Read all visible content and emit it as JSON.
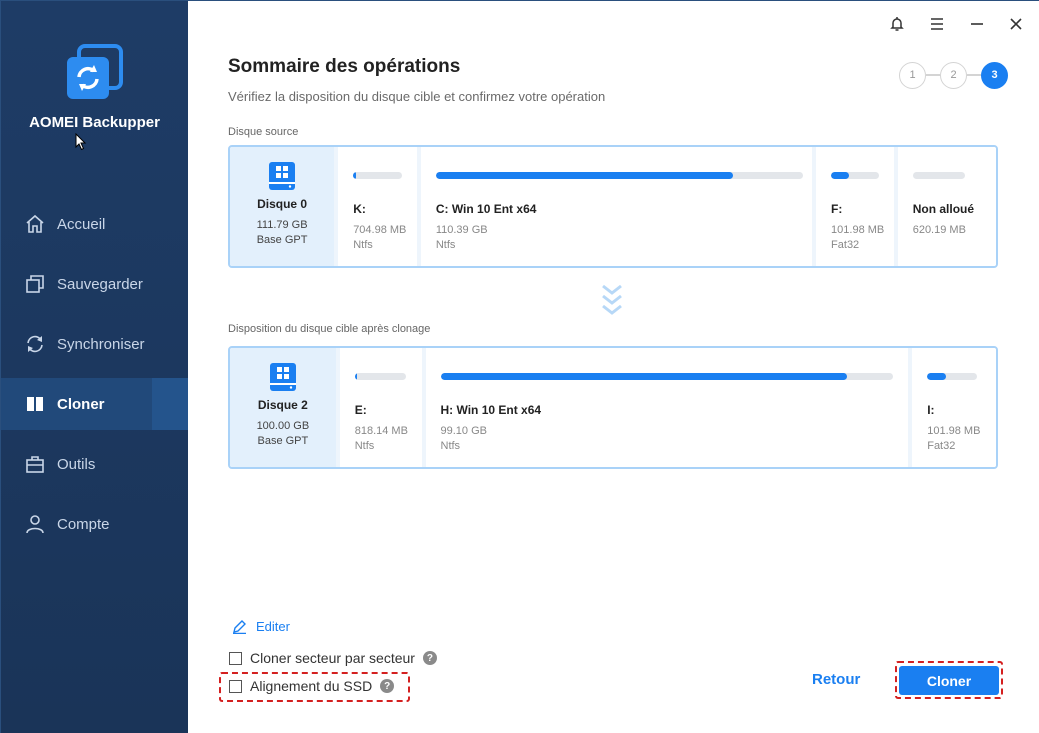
{
  "app": {
    "name": "AOMEI Backupper"
  },
  "nav": [
    {
      "label": "Accueil",
      "icon": "home-icon"
    },
    {
      "label": "Sauvegarder",
      "icon": "backup-icon"
    },
    {
      "label": "Synchroniser",
      "icon": "sync-icon"
    },
    {
      "label": "Cloner",
      "icon": "clone-icon",
      "active": true
    },
    {
      "label": "Outils",
      "icon": "toolbox-icon"
    },
    {
      "label": "Compte",
      "icon": "user-icon"
    }
  ],
  "header": {
    "title": "Sommaire des opérations",
    "subtitle": "Vérifiez la disposition du disque cible et confirmez votre opération",
    "steps": [
      "1",
      "2",
      "3"
    ],
    "active_step": 3
  },
  "source": {
    "label": "Disque source",
    "disk": {
      "name": "Disque 0",
      "size": "111.79 GB",
      "type": "Base GPT"
    },
    "partitions": [
      {
        "label": "K:",
        "size": "704.98 MB",
        "fs": "Ntfs",
        "fill": 0.05
      },
      {
        "label": "C: Win 10 Ent x64",
        "size": "110.39 GB",
        "fs": "Ntfs",
        "fill": 0.81
      },
      {
        "label": "F:",
        "size": "101.98 MB",
        "fs": "Fat32",
        "fill": 0.38
      },
      {
        "label": "Non alloué",
        "size": "620.19 MB",
        "fs": "",
        "fill": 0
      }
    ]
  },
  "target": {
    "label": "Disposition du disque cible après clonage",
    "disk": {
      "name": "Disque 2",
      "size": "100.00 GB",
      "type": "Base GPT"
    },
    "partitions": [
      {
        "label": "E:",
        "size": "818.14 MB",
        "fs": "Ntfs",
        "fill": 0.05
      },
      {
        "label": "H: Win 10 Ent x64",
        "size": "99.10 GB",
        "fs": "Ntfs",
        "fill": 0.9
      },
      {
        "label": "I:",
        "size": "101.98 MB",
        "fs": "Fat32",
        "fill": 0.38
      }
    ]
  },
  "options": {
    "edit_label": "Editer",
    "sector_label": "Cloner secteur par secteur",
    "ssd_label": "Alignement du SSD",
    "help": "?"
  },
  "buttons": {
    "back": "Retour",
    "clone": "Cloner"
  },
  "colors": {
    "accent": "#1a7ff1",
    "sidebar": "#1e3c66",
    "highlight": "#d42020"
  }
}
